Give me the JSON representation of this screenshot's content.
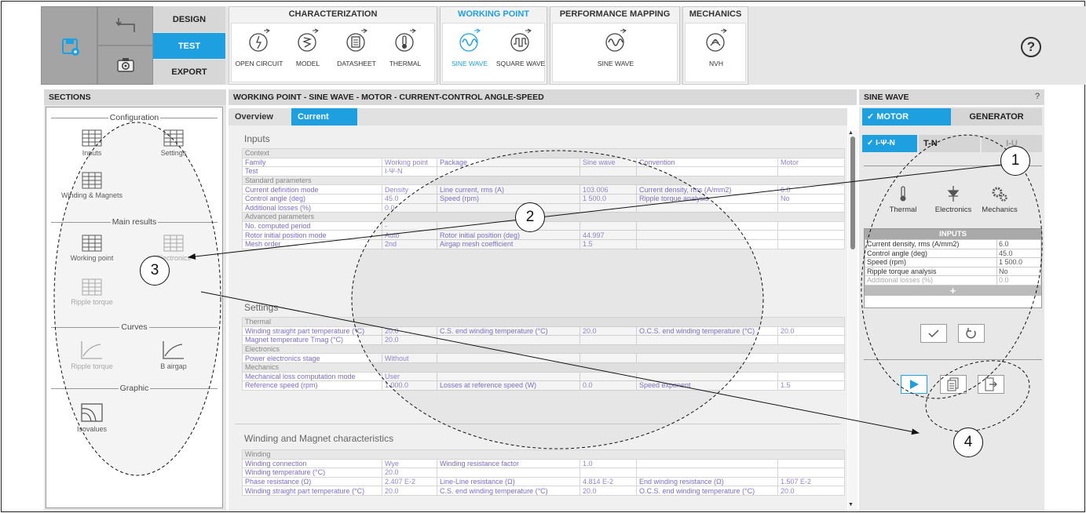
{
  "toolbar": {
    "modes": [
      "DESIGN",
      "TEST",
      "EXPORT"
    ],
    "active_mode": "TEST",
    "groups": [
      {
        "title": "CHARACTERIZATION",
        "tools": [
          "OPEN CIRCUIT",
          "MODEL",
          "DATASHEET",
          "THERMAL"
        ]
      },
      {
        "title": "WORKING POINT",
        "tools": [
          "SINE WAVE",
          "SQUARE WAVE"
        ]
      },
      {
        "title": "PERFORMANCE MAPPING",
        "tools": [
          "SINE WAVE"
        ]
      },
      {
        "title": "MECHANICS",
        "tools": [
          "NVH"
        ]
      }
    ],
    "active_group": "WORKING POINT",
    "active_tool": "SINE WAVE",
    "help_glyph": "?"
  },
  "sections": {
    "title": "SECTIONS",
    "categories": [
      "Configuration",
      "Main results",
      "Curves",
      "Graphic"
    ],
    "items": [
      "Inputs",
      "Settings",
      "Winding & Magnets",
      "Working point",
      "Electronics",
      "Ripple torque",
      "Ripple torque",
      "B airgap",
      "Isovalues"
    ],
    "arrow": ">"
  },
  "main": {
    "title": "WORKING POINT - SINE WAVE - MOTOR - CURRENT-CONTROL ANGLE-SPEED",
    "tabs": [
      "Overview",
      "Current"
    ],
    "active_tab": "Current",
    "blocks": [
      {
        "title": "Inputs",
        "rows": [
          {
            "group": "Context"
          },
          {
            "cells": [
              "Family",
              "Working point",
              "Package",
              "Sine wave",
              "Convention",
              "Motor"
            ]
          },
          {
            "cells": [
              "Test",
              "I-Ψ-N",
              "",
              "",
              "",
              ""
            ]
          },
          {
            "group": "Standard parameters"
          },
          {
            "cells": [
              "Current definition mode",
              "Density",
              "Line current, rms (A)",
              "103.006",
              "Current density, rms (A/mm2)",
              "6.0"
            ]
          },
          {
            "cells": [
              "Control angle (deg)",
              "45.0",
              "Speed (rpm)",
              "1 500.0",
              "Ripple torque analysis",
              "No"
            ]
          },
          {
            "cells": [
              "Additional losses (%)",
              "0.0",
              "",
              "",
              "",
              ""
            ]
          },
          {
            "group": "Advanced parameters"
          },
          {
            "cells": [
              "No. computed period",
              "-",
              "",
              "",
              "",
              ""
            ]
          },
          {
            "cells": [
              "Rotor initial position mode",
              "Auto",
              "Rotor initial position (deg)",
              "44.997",
              "",
              ""
            ]
          },
          {
            "cells": [
              "Mesh order",
              "2nd",
              "Airgap mesh coefficient",
              "1.5",
              "",
              ""
            ]
          }
        ]
      },
      {
        "title": "Settings",
        "rows": [
          {
            "group": "Thermal"
          },
          {
            "cells": [
              "Winding straight part temperature (°C)",
              "20.0",
              "C.S. end winding temperature (°C)",
              "20.0",
              "O.C.S. end winding temperature (°C)",
              "20.0"
            ]
          },
          {
            "cells": [
              "Magnet temperature Tmag (°C)",
              "20.0",
              "",
              "",
              "",
              ""
            ]
          },
          {
            "group": "Electronics"
          },
          {
            "cells": [
              "Power electronics stage",
              "Without",
              "",
              "",
              "",
              ""
            ]
          },
          {
            "group": "Mechanics"
          },
          {
            "cells": [
              "Mechanical loss computation mode",
              "User",
              "",
              "",
              "",
              ""
            ]
          },
          {
            "cells": [
              "Reference speed (rpm)",
              "1 000.0",
              "Losses at reference speed (W)",
              "0.0",
              "Speed exponent",
              "1.5"
            ]
          }
        ]
      },
      {
        "title": "Winding and Magnet characteristics",
        "rows": [
          {
            "group": "Winding"
          },
          {
            "cells": [
              "Winding connection",
              "Wye",
              "Winding resistance factor",
              "1.0",
              "",
              ""
            ]
          },
          {
            "cells": [
              "Winding temperature (°C)",
              "20.0",
              "",
              "",
              "",
              ""
            ]
          },
          {
            "cells": [
              "Phase resistance (Ω)",
              "2.407 E-2",
              "Line-Line resistance (Ω)",
              "4.814 E-2",
              "End winding resistance (Ω)",
              "1.507 E-2"
            ]
          },
          {
            "cells": [
              "Winding straight part temperature (°C)",
              "20.0",
              "C.S. end winding temperature (°C)",
              "20.0",
              "O.C.S. end winding temperature (°C)",
              "20.0"
            ]
          }
        ]
      }
    ]
  },
  "right": {
    "title": "SINE WAVE",
    "help_glyph": "?",
    "modes": [
      "✓ MOTOR",
      "GENERATOR"
    ],
    "sub_modes": [
      "✓ I-Ψ-N",
      "T-N",
      "I-U"
    ],
    "options": [
      "Thermal",
      "Electronics",
      "Mechanics"
    ],
    "inputs_title": "INPUTS",
    "inputs": [
      {
        "label": "Current density, rms (A/mm2)",
        "value": "6.0"
      },
      {
        "label": "Control angle (deg)",
        "value": "45.0"
      },
      {
        "label": "Speed (rpm)",
        "value": "1 500.0"
      },
      {
        "label": "Ripple torque analysis",
        "value": "No"
      },
      {
        "label": "Additional losses (%)",
        "value": "0.0"
      }
    ],
    "plus": "+"
  },
  "annotations": [
    "1",
    "2",
    "3",
    "4"
  ],
  "colors": {
    "accent": "#1ea0e0",
    "label": "#7a6cc7"
  }
}
